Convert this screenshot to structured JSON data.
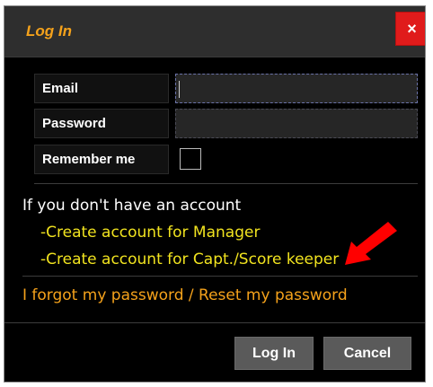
{
  "dialog": {
    "title": "Log In",
    "close_label": "×"
  },
  "form": {
    "email_label": "Email",
    "email_value": "",
    "password_label": "Password",
    "password_value": "",
    "remember_label": "Remember me",
    "remember_checked": false
  },
  "account": {
    "intro_text": "If you don't have an account",
    "create_manager": "-Create account for Manager",
    "create_captain": "-Create account for Capt./Score keeper"
  },
  "reset_link": "I forgot my password / Reset my password",
  "buttons": {
    "login_label": "Log In",
    "cancel_label": "Cancel"
  },
  "colors": {
    "accent_orange": "#f5a21b",
    "link_yellow": "#f1e31f",
    "close_red": "#e01b1b",
    "annotation_arrow": "#ff0000"
  },
  "icons": {
    "close": "close-icon",
    "annotation": "red-arrow-icon"
  }
}
